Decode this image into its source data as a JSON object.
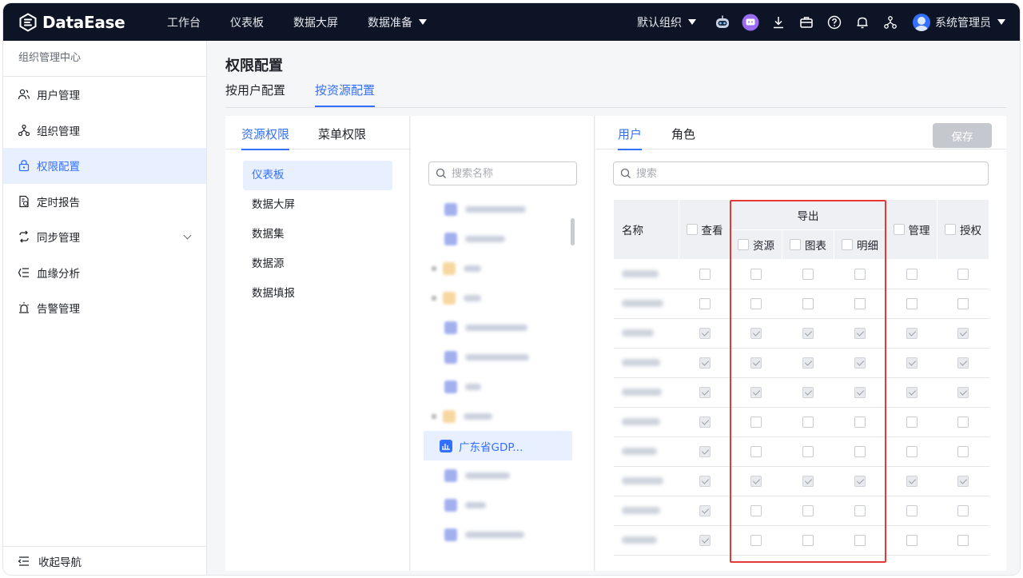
{
  "app": {
    "brand": "DataEase",
    "accent": "#3370ff",
    "topbar_bg": "#0d1426",
    "highlight_color": "#e53935"
  },
  "topnav": {
    "items": [
      {
        "label": "工作台"
      },
      {
        "label": "仪表板"
      },
      {
        "label": "数据大屏"
      },
      {
        "label": "数据准备",
        "has_dropdown": true
      }
    ],
    "org_label": "默认组织",
    "icons": [
      "robot-icon",
      "ai-assistant-icon",
      "download-icon",
      "briefcase-icon",
      "help-icon",
      "bell-icon",
      "org-tree-icon"
    ],
    "user_name": "系统管理员"
  },
  "sidebar": {
    "title": "组织管理中心",
    "items": [
      {
        "label": "用户管理",
        "icon": "users-icon"
      },
      {
        "label": "组织管理",
        "icon": "org-icon"
      },
      {
        "label": "权限配置",
        "icon": "lock-icon",
        "active": true
      },
      {
        "label": "定时报告",
        "icon": "report-icon"
      },
      {
        "label": "同步管理",
        "icon": "sync-icon",
        "has_children": true
      },
      {
        "label": "血缘分析",
        "icon": "lineage-icon"
      },
      {
        "label": "告警管理",
        "icon": "alarm-icon"
      }
    ],
    "collapse_label": "收起导航"
  },
  "main": {
    "title": "权限配置",
    "tabs": [
      {
        "label": "按用户配置"
      },
      {
        "label": "按资源配置",
        "active": true
      }
    ]
  },
  "left_panel": {
    "tabs": [
      {
        "label": "资源权限",
        "active": true
      },
      {
        "label": "菜单权限"
      }
    ],
    "resource_types": [
      {
        "label": "仪表板",
        "active": true
      },
      {
        "label": "数据大屏"
      },
      {
        "label": "数据集"
      },
      {
        "label": "数据源"
      },
      {
        "label": "数据填报"
      }
    ]
  },
  "tree_panel": {
    "search_placeholder": "搜索名称",
    "selected_node_label": "广东省GDP..."
  },
  "right_panel": {
    "tabs": [
      {
        "label": "用户",
        "active": true
      },
      {
        "label": "角色"
      }
    ],
    "save_label": "保存",
    "search_placeholder": "搜索",
    "headers": {
      "name": "名称",
      "view": "查看",
      "export": "导出",
      "export_resource": "资源",
      "export_chart": "图表",
      "export_detail": "明细",
      "manage": "管理",
      "grant": "授权"
    },
    "rows": [
      [
        false,
        false,
        false,
        false,
        false,
        false
      ],
      [
        false,
        false,
        false,
        false,
        false,
        false
      ],
      [
        true,
        true,
        true,
        true,
        true,
        true
      ],
      [
        true,
        true,
        true,
        true,
        true,
        true
      ],
      [
        true,
        true,
        true,
        true,
        true,
        true
      ],
      [
        true,
        false,
        false,
        false,
        false,
        false
      ],
      [
        true,
        false,
        false,
        false,
        false,
        false
      ],
      [
        true,
        true,
        true,
        true,
        true,
        true
      ],
      [
        true,
        false,
        false,
        false,
        false,
        false
      ],
      [
        true,
        false,
        false,
        false,
        false,
        false
      ]
    ]
  }
}
